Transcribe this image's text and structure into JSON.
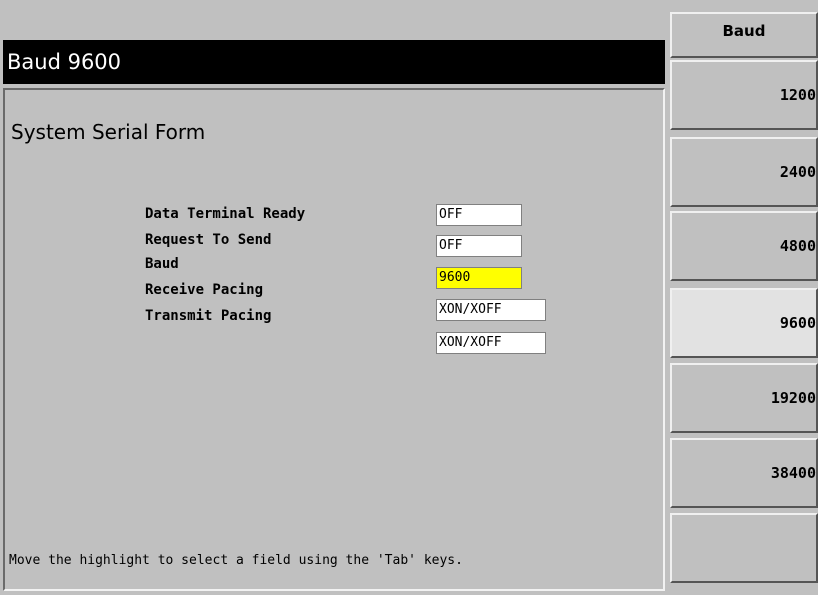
{
  "title_bar": {
    "text": "Baud 9600"
  },
  "form": {
    "title": "System Serial Form",
    "fields": [
      {
        "label": "Data Terminal Ready",
        "value": "OFF"
      },
      {
        "label": "Request To Send",
        "value": "OFF"
      },
      {
        "label": "Baud",
        "value": "9600",
        "highlighted": true
      },
      {
        "label": "Receive Pacing",
        "value": "XON/XOFF"
      },
      {
        "label": "Transmit Pacing",
        "value": "XON/XOFF"
      }
    ],
    "help_text": "Move the highlight to select a field using the 'Tab' keys."
  },
  "softkeys": {
    "title": "Baud",
    "keys": [
      {
        "label": "1200"
      },
      {
        "label": "2400"
      },
      {
        "label": "4800"
      },
      {
        "label": "9600",
        "selected": true
      },
      {
        "label": "19200"
      },
      {
        "label": "38400"
      },
      {
        "label": ""
      }
    ]
  },
  "colors": {
    "background": "#c0c0c0",
    "title_bar_bg": "#000000",
    "title_bar_fg": "#ffffff",
    "highlight": "#ffff00",
    "field_bg": "#ffffff"
  }
}
